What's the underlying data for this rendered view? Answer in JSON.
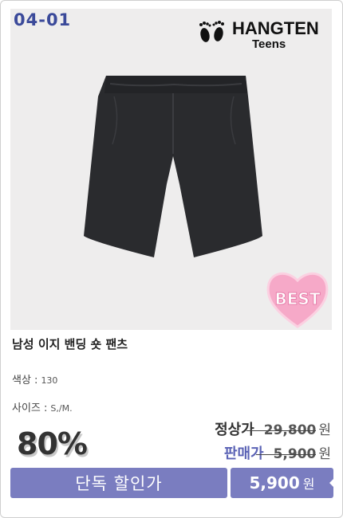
{
  "product": {
    "code": "04-01",
    "brand_main": "HANGTEN",
    "brand_sub": "Teens",
    "badge": "BEST",
    "title": "남성 이지 밴딩 숏 팬츠",
    "color_label": "색상 :",
    "color_value": "130",
    "size_label": "사이즈 :",
    "size_value": "S,/M."
  },
  "pricing": {
    "discount": "80%",
    "regular_label": "정상가",
    "regular_price": "29,800",
    "sale_label": "판매가",
    "sale_price": "5,900",
    "currency": "원"
  },
  "promo": {
    "label": "단독 할인가",
    "price": "5,900",
    "currency": "원"
  },
  "colors": {
    "accent": "#7a7dc0",
    "code_text": "#3b4a9a",
    "regular_label": "#333333",
    "sale_label": "#5a62b5",
    "photo_bg": "#eeeded",
    "badge_heart": "#f6a9c8"
  },
  "icons": [
    "footprints-logo-icon",
    "heart-badge-icon"
  ]
}
